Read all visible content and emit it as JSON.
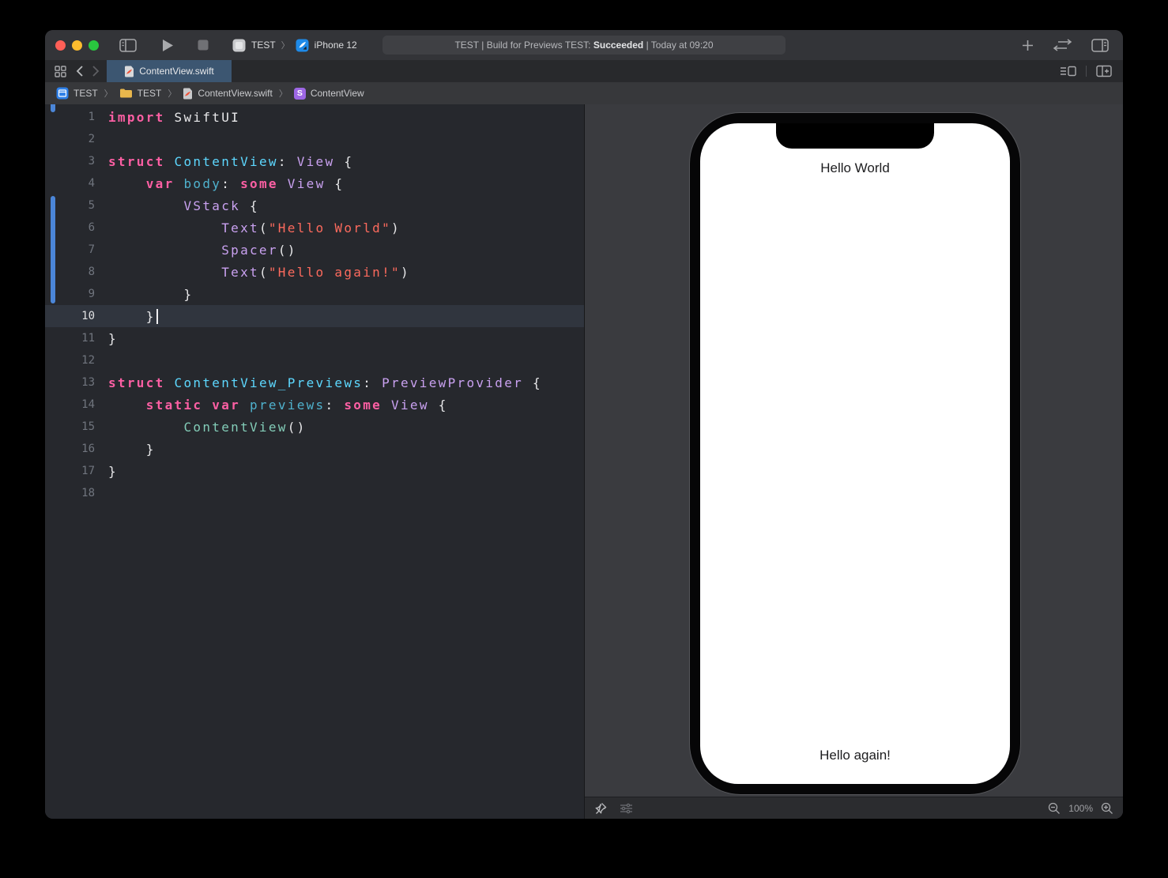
{
  "window": {
    "titlebar": {
      "scheme_project": "TEST",
      "scheme_device": "iPhone 12",
      "status_prefix": "TEST | Build for Previews TEST: ",
      "status_bold": "Succeeded",
      "status_suffix": " | Today at 09:20"
    },
    "tabbar": {
      "active_tab": "ContentView.swift"
    },
    "jumpbar": {
      "items": [
        "TEST",
        "TEST",
        "ContentView.swift",
        "ContentView"
      ]
    }
  },
  "editor": {
    "current_line": 10,
    "colors": {
      "kw": "#FC5FA3",
      "pl": "#E8E8EA",
      "td": "#5DD8FF",
      "md": "#4FB2CE",
      "ot": "#C9A1F0",
      "st": "#FC6A5D",
      "pt": "#83CDB8",
      "change_bar": "#4B86D8"
    },
    "lines": [
      {
        "n": 1,
        "tokens": [
          [
            "kw",
            "import"
          ],
          [
            "pl",
            " SwiftUI"
          ]
        ]
      },
      {
        "n": 2,
        "tokens": []
      },
      {
        "n": 3,
        "tokens": [
          [
            "kw",
            "struct"
          ],
          [
            "pl",
            " "
          ],
          [
            "td",
            "ContentView"
          ],
          [
            "pl",
            ": "
          ],
          [
            "ot",
            "View"
          ],
          [
            "pl",
            " {"
          ]
        ]
      },
      {
        "n": 4,
        "tokens": [
          [
            "pl",
            "    "
          ],
          [
            "kw",
            "var"
          ],
          [
            "pl",
            " "
          ],
          [
            "md",
            "body"
          ],
          [
            "pl",
            ": "
          ],
          [
            "kw",
            "some"
          ],
          [
            "pl",
            " "
          ],
          [
            "ot",
            "View"
          ],
          [
            "pl",
            " {"
          ]
        ]
      },
      {
        "n": 5,
        "tokens": [
          [
            "pl",
            "        "
          ],
          [
            "ot",
            "VStack"
          ],
          [
            "pl",
            " {"
          ]
        ]
      },
      {
        "n": 6,
        "tokens": [
          [
            "pl",
            "            "
          ],
          [
            "ot",
            "Text"
          ],
          [
            "pl",
            "("
          ],
          [
            "st",
            "\"Hello World\""
          ],
          [
            "pl",
            ")"
          ]
        ]
      },
      {
        "n": 7,
        "tokens": [
          [
            "pl",
            "            "
          ],
          [
            "ot",
            "Spacer"
          ],
          [
            "pl",
            "()"
          ]
        ]
      },
      {
        "n": 8,
        "tokens": [
          [
            "pl",
            "            "
          ],
          [
            "ot",
            "Text"
          ],
          [
            "pl",
            "("
          ],
          [
            "st",
            "\"Hello again!\""
          ],
          [
            "pl",
            ")"
          ]
        ]
      },
      {
        "n": 9,
        "tokens": [
          [
            "pl",
            "        }"
          ]
        ]
      },
      {
        "n": 10,
        "tokens": [
          [
            "pl",
            "    }"
          ]
        ]
      },
      {
        "n": 11,
        "tokens": [
          [
            "pl",
            "}"
          ]
        ]
      },
      {
        "n": 12,
        "tokens": []
      },
      {
        "n": 13,
        "tokens": [
          [
            "kw",
            "struct"
          ],
          [
            "pl",
            " "
          ],
          [
            "td",
            "ContentView_Previews"
          ],
          [
            "pl",
            ": "
          ],
          [
            "ot",
            "PreviewProvider"
          ],
          [
            "pl",
            " {"
          ]
        ]
      },
      {
        "n": 14,
        "tokens": [
          [
            "pl",
            "    "
          ],
          [
            "kw",
            "static"
          ],
          [
            "pl",
            " "
          ],
          [
            "kw",
            "var"
          ],
          [
            "pl",
            " "
          ],
          [
            "md",
            "previews"
          ],
          [
            "pl",
            ": "
          ],
          [
            "kw",
            "some"
          ],
          [
            "pl",
            " "
          ],
          [
            "ot",
            "View"
          ],
          [
            "pl",
            " {"
          ]
        ]
      },
      {
        "n": 15,
        "tokens": [
          [
            "pl",
            "        "
          ],
          [
            "pt",
            "ContentView"
          ],
          [
            "pl",
            "()"
          ]
        ]
      },
      {
        "n": 16,
        "tokens": [
          [
            "pl",
            "    }"
          ]
        ]
      },
      {
        "n": 17,
        "tokens": [
          [
            "pl",
            "}"
          ]
        ]
      },
      {
        "n": 18,
        "tokens": []
      }
    ]
  },
  "preview": {
    "text_top": "Hello World",
    "text_bottom": "Hello again!",
    "zoom_level": "100%"
  },
  "colors": {
    "traffic_red": "#FF5F57",
    "traffic_yellow": "#FEBC2E",
    "traffic_green": "#29C73F",
    "tab_active": "#3C5671",
    "simulator_blue": "#1E8AE8",
    "folder_yellow": "#E8B64C"
  }
}
